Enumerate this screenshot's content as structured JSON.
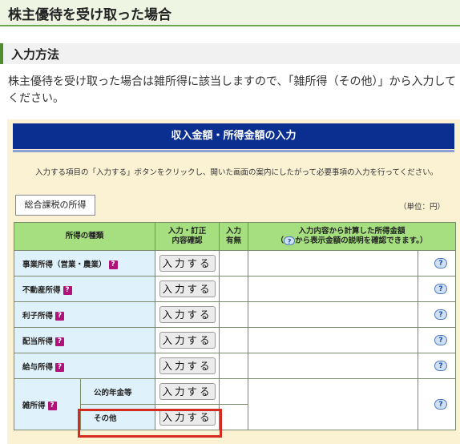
{
  "header": {
    "title": "株主優待を受け取った場合"
  },
  "section": {
    "title": "入力方法"
  },
  "description": "株主優待を受け取った場合は雑所得に該当しますので、「雑所得（その他）」から入力してください。",
  "panel": {
    "banner": "収入金額・所得金額の入力",
    "instruction": "入力する項目の「入力する」ボタンをクリックし、開いた画面の案内にしたがって必要事項の入力を行ってください。",
    "tab": "総合課税の所得",
    "unit": "（単位：円）"
  },
  "table": {
    "headers": {
      "kind": "所得の種類",
      "edit1": "入力・訂正",
      "edit2": "内容確認",
      "status1": "入力",
      "status2": "有無",
      "amount1": "入力内容から計算した所得金額",
      "amount2_pre": "（",
      "amount2_post": "から表示金額の説明を確認できます。）"
    },
    "button_label": "入力する",
    "help_mark": "?",
    "rows": [
      {
        "label": "事業所得（営業・農業）"
      },
      {
        "label": "不動産所得"
      },
      {
        "label": "利子所得"
      },
      {
        "label": "配当所得"
      },
      {
        "label": "給与所得"
      }
    ],
    "misc": {
      "label": "雑所得",
      "sub": [
        {
          "label": "公的年金等"
        },
        {
          "label": "その他"
        }
      ]
    }
  }
}
